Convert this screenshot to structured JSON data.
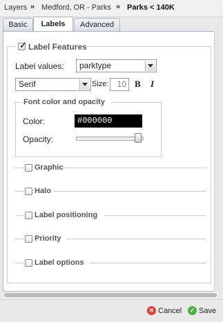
{
  "breadcrumb": {
    "items": [
      "Layers",
      "Medford, OR - Parks",
      "Parks < 140K"
    ],
    "separator": "»"
  },
  "tabs": [
    {
      "label": "Basic",
      "active": false
    },
    {
      "label": "Labels",
      "active": true
    },
    {
      "label": "Advanced",
      "active": false
    }
  ],
  "label_features": {
    "title": "Label Features",
    "checked": true,
    "label_values_label": "Label values:",
    "label_values_selected": "parktype",
    "font_family_selected": "Serif",
    "size_label": "Size:",
    "size_value": "10",
    "bold_label": "B",
    "italic_label": "I"
  },
  "font_color": {
    "title": "Font color and opacity",
    "color_label": "Color:",
    "color_value": "#000000",
    "opacity_label": "Opacity:",
    "opacity_level": 1.0
  },
  "sections": [
    {
      "label": "Graphic",
      "checked": false
    },
    {
      "label": "Halo",
      "checked": false
    },
    {
      "label": "Label positioning",
      "checked": false
    },
    {
      "label": "Priority",
      "checked": false
    },
    {
      "label": "Label options",
      "checked": false
    }
  ],
  "footer": {
    "cancel_label": "Cancel",
    "save_label": "Save"
  },
  "colors": {
    "cancel_icon": "#d9413a",
    "save_icon": "#4caf3f",
    "tab_border": "#aab4c2"
  }
}
